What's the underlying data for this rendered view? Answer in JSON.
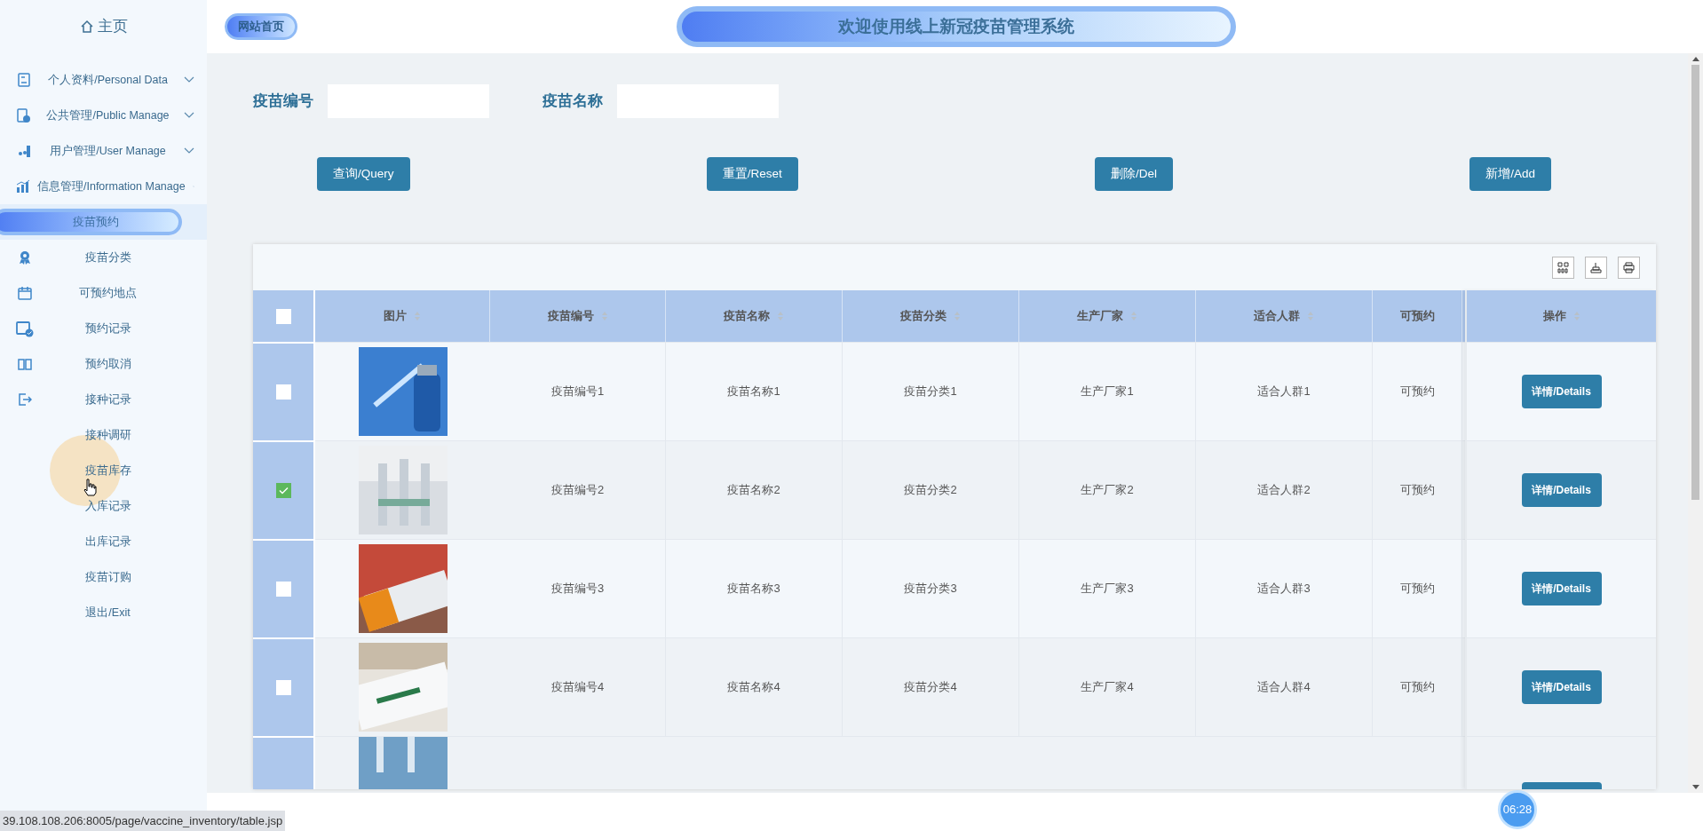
{
  "sidebar": {
    "home": "主页",
    "groups": [
      {
        "label": "个人资料/Personal Data",
        "expanded": false
      },
      {
        "label": "公共管理/Public Manage",
        "expanded": false
      },
      {
        "label": "用户管理/User Manage",
        "expanded": false
      },
      {
        "label": "信息管理/Information Manage",
        "expanded": true
      }
    ],
    "items": [
      {
        "label": "疫苗预约",
        "selected": true
      },
      {
        "label": "疫苗分类",
        "selected": false
      },
      {
        "label": "可预约地点",
        "selected": false
      },
      {
        "label": "预约记录",
        "selected": false
      },
      {
        "label": "预约取消",
        "selected": false
      },
      {
        "label": "接种记录",
        "selected": false
      },
      {
        "label": "接种调研",
        "selected": false
      },
      {
        "label": "疫苗库存",
        "selected": false
      },
      {
        "label": "入库记录",
        "selected": false
      },
      {
        "label": "出库记录",
        "selected": false
      },
      {
        "label": "疫苗订购",
        "selected": false
      },
      {
        "label": "退出/Exit",
        "selected": false
      }
    ]
  },
  "header": {
    "home_link": "网站首页",
    "title": "欢迎使用线上新冠疫苗管理系统"
  },
  "search": [
    {
      "label": "疫苗编号"
    },
    {
      "label": "疫苗名称"
    }
  ],
  "buttons": [
    "查询/Query",
    "重置/Reset",
    "删除/Del",
    "新增/Add"
  ],
  "table": {
    "select_all": {
      "checked": false
    },
    "columns": [
      "图片",
      "疫苗编号",
      "疫苗名称",
      "疫苗分类",
      "生产厂家",
      "适合人群",
      "可预约",
      "操作"
    ],
    "rows": [
      {
        "selected": false,
        "cells": [
          {
            "kind": "picture"
          },
          {
            "kind": "text",
            "text": "疫苗编号1"
          },
          {
            "kind": "text",
            "text": "疫苗名称1"
          },
          {
            "kind": "text",
            "text": "疫苗分类1"
          },
          {
            "kind": "text",
            "text": "生产厂家1"
          },
          {
            "kind": "text",
            "text": "适合人群1"
          },
          {
            "kind": "text",
            "text": "可预约"
          },
          {
            "kind": "button",
            "text": "详情/Details"
          }
        ]
      },
      {
        "selected": true,
        "cells": [
          {
            "kind": "picture"
          },
          {
            "kind": "text",
            "text": "疫苗编号2"
          },
          {
            "kind": "text",
            "text": "疫苗名称2"
          },
          {
            "kind": "text",
            "text": "疫苗分类2"
          },
          {
            "kind": "text",
            "text": "生产厂家2"
          },
          {
            "kind": "text",
            "text": "适合人群2"
          },
          {
            "kind": "text",
            "text": "可预约"
          },
          {
            "kind": "button",
            "text": "详情/Details"
          }
        ]
      },
      {
        "selected": false,
        "cells": [
          {
            "kind": "picture"
          },
          {
            "kind": "text",
            "text": "疫苗编号3"
          },
          {
            "kind": "text",
            "text": "疫苗名称3"
          },
          {
            "kind": "text",
            "text": "疫苗分类3"
          },
          {
            "kind": "text",
            "text": "生产厂家3"
          },
          {
            "kind": "text",
            "text": "适合人群3"
          },
          {
            "kind": "text",
            "text": "可预约"
          },
          {
            "kind": "button",
            "text": "详情/Details"
          }
        ]
      },
      {
        "selected": false,
        "cells": [
          {
            "kind": "picture"
          },
          {
            "kind": "text",
            "text": "疫苗编号4"
          },
          {
            "kind": "text",
            "text": "疫苗名称4"
          },
          {
            "kind": "text",
            "text": "疫苗分类4"
          },
          {
            "kind": "text",
            "text": "生产厂家4"
          },
          {
            "kind": "text",
            "text": "适合人群4"
          },
          {
            "kind": "text",
            "text": "可预约"
          },
          {
            "kind": "button",
            "text": "详情/Details"
          }
        ]
      }
    ]
  },
  "status_url": "39.108.108.206:8005/page/vaccine_inventory/table.jsp",
  "timer": "06:28"
}
